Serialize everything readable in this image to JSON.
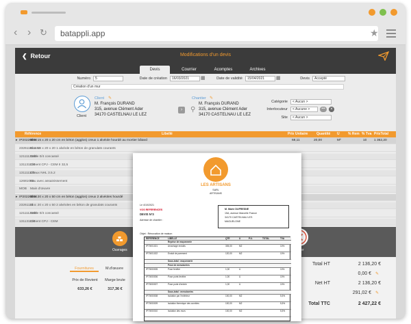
{
  "browser": {
    "url": "batappli.app",
    "dots": [
      "#f29a2e",
      "#7fc04e",
      "#f29a2e"
    ]
  },
  "app": {
    "back_label": "Retour",
    "title": "Modifications d'un devis",
    "accent": "#f29a2e",
    "tabs": [
      "Devis",
      "Courrier",
      "Acomptes",
      "Archives"
    ]
  },
  "form": {
    "numero_label": "Numéro",
    "numero_value": "5",
    "creation_label": "Date de création",
    "creation_value": "16/03/2021",
    "validite_label": "Date de validité",
    "validite_value": "15/04/2021",
    "devis_label": "Devis",
    "devis_value": "Accepté",
    "object_value": "Création d'un mur"
  },
  "client": {
    "label": "Client",
    "caption": "Client",
    "lines": [
      "M. François DURAND",
      "315, avenue Clément Ader",
      "34170 CASTELNAU LE LEZ"
    ]
  },
  "chantier": {
    "label": "Chantier",
    "lines": [
      "M. François DURAND",
      "315, avenue Clément Ader",
      "34170 CASTELNAU LE LEZ"
    ]
  },
  "selects": {
    "categorie_label": "Catégorie",
    "categorie_value": "< Aucun >",
    "interlocuteur_label": "Interlocuteur",
    "interlocuteur_value": "< Aucune >",
    "site_label": "Site",
    "site_value": "< Aucun >"
  },
  "table": {
    "headers": [
      "Référence",
      "Libellé",
      "Prix Unitaire",
      "Quantité",
      "U",
      "% Rem",
      "% Tva",
      "PrixTotal"
    ],
    "rows": [
      {
        "ref": "IP20220006",
        "label": "Bloc 15 x 20 x 20 cm en béton (agglos) creux 1 alvéole hourdé au mortier bâtard",
        "pu": "68,11",
        "qty": "20,00",
        "u": "M²",
        "rem": "",
        "tva": "10",
        "total": "1 362,20",
        "dark": true
      },
      {
        "ref": "232611011152",
        "label": "Bloc 15 x 20 x 20 1 alvéole en béton de granulats courants",
        "pu": "",
        "qty": "",
        "u": "",
        "rem": "",
        "tva": "",
        "total": "",
        "dark": false
      },
      {
        "ref": "1211112200",
        "label": "Sable 0/4 concassé",
        "pu": "",
        "qty": "",
        "u": "",
        "rem": "",
        "tva": "",
        "total": "",
        "dark": false
      },
      {
        "ref": "131131100",
        "label": "Ciment CPJ - CEM II 32,5",
        "pu": "",
        "qty": "",
        "u": "",
        "rem": "",
        "tva": "",
        "total": "",
        "dark": false
      },
      {
        "ref": "131111100",
        "label": "Chaux NHL 3.5.2",
        "pu": "",
        "qty": "",
        "u": "",
        "rem": "",
        "tva": "",
        "total": "",
        "dark": false
      },
      {
        "ref": "12681000",
        "label": "Eau avec assainissement",
        "pu": "",
        "qty": "",
        "u": "",
        "rem": "",
        "tva": "",
        "total": "",
        "dark": false
      },
      {
        "ref": "MOB",
        "label": "Main d'œuvre",
        "pu": "",
        "qty": "",
        "u": "",
        "rem": "",
        "tva": "",
        "total": "",
        "dark": false
      },
      {
        "ref": "IP20220006",
        "label": "Bloc 20 x 20 x 50 cm en béton (agglos) creux 2 alvéoles hourdé",
        "pu": "",
        "qty": "",
        "u": "",
        "rem": "",
        "tva": "",
        "total": "",
        "dark": true
      },
      {
        "ref": "23261111",
        "label": "Bloc 20 x 20 x 50 2 alvéoles en béton de granulats courants",
        "pu": "",
        "qty": "",
        "u": "",
        "rem": "",
        "tva": "",
        "total": "",
        "dark": false
      },
      {
        "ref": "1211112200",
        "label": "Sable 0/4 concassé",
        "pu": "",
        "qty": "",
        "u": "",
        "rem": "",
        "tva": "",
        "total": "",
        "dark": false
      },
      {
        "ref": "131131100",
        "label": "Ciment CPJ - CEM",
        "pu": "",
        "qty": "",
        "u": "",
        "rem": "",
        "tva": "",
        "total": "",
        "dark": false
      }
    ]
  },
  "toolbar": {
    "ouvrages_label": "Ouvrages",
    "effacer_label": "Effacer"
  },
  "bottom": {
    "tabs": [
      "Fournitures",
      "M.d'œuvre"
    ],
    "col1_label": "Prix de Revient",
    "col1_value": "633,26 €",
    "col2_label": "Marge brute",
    "col2_value": "317,36 €"
  },
  "totals": {
    "ht_label": "Total HT",
    "ht_value": "2 136,20 €",
    "remise_value": "0,00 €",
    "net_label": "Net HT",
    "net_value": "2 136,20 €",
    "tva_value": "291,02 €",
    "ttc_label": "Total TTC",
    "ttc_value": "2 427,22 €"
  },
  "doc": {
    "brand": "LES ARTISANS",
    "brand_sub": "SARL",
    "brand_sub2": "ARTISANS",
    "date_line": "Le 4/10/2021",
    "ref_line": "VOS REFERENCES",
    "devis_no": "DEVIS N°3",
    "chantier_line": "Adresse de chantier :",
    "recipient": [
      "M. Marie DUFRESNE",
      "15A, avenue Marcelle France",
      "34170 CASTELNAU LES",
      "MAGUELONE"
    ],
    "objet": "Objet : Rénovation de maison",
    "headers": [
      "REFERENCE",
      "LIBELLE",
      "QTE",
      "U",
      "P.U.",
      "TOTAL",
      "TVA"
    ],
    "rows": [
      {
        "ref": "",
        "label": "Reprise de maçonnerie",
        "qty": "",
        "u": "",
        "pu": "",
        "total": "",
        "tva": ""
      },
      {
        "ref": "IP70001021",
        "label": "Arrachage enduits",
        "qty": "305,00",
        "u": "M2",
        "pu": "",
        "total": "",
        "tva": "10%"
      },
      {
        "ref": "IP70001022",
        "label": "Enduit de parement",
        "qty": "120,00",
        "u": "M2",
        "pu": "",
        "total": "",
        "tva": "10%"
      },
      {
        "ref": "",
        "label": "Sous-total : maçonnerie",
        "qty": "",
        "u": "",
        "pu": "",
        "total": "",
        "tva": ""
      },
      {
        "ref": "",
        "label": "Pose de menuiseries",
        "qty": "",
        "u": "",
        "pu": "",
        "total": "",
        "tva": ""
      },
      {
        "ref": "IP70000005",
        "label": "Pose fenêtre",
        "qty": "1,00",
        "u": "U",
        "pu": "",
        "total": "",
        "tva": "10%"
      },
      {
        "ref": "IP70000006",
        "label": "Pose porte-fenêtre",
        "qty": "1,00",
        "u": "U",
        "pu": "",
        "total": "",
        "tva": "10%"
      },
      {
        "ref": "IP70000007",
        "label": "Pose porte d'entrée",
        "qty": "1,00",
        "u": "U",
        "pu": "",
        "total": "",
        "tva": "10%"
      },
      {
        "ref": "",
        "label": "Sous-total : menuiseries",
        "qty": "",
        "u": "",
        "pu": "",
        "total": "",
        "tva": ""
      },
      {
        "ref": "IP70000008",
        "label": "Isolation par l'extérieur",
        "qty": "100,00",
        "u": "M2",
        "pu": "",
        "total": "",
        "tva": "5,5%"
      },
      {
        "ref": "IP70000009",
        "label": "Isolation thermique des combles",
        "qty": "100,00",
        "u": "M2",
        "pu": "",
        "total": "",
        "tva": "5,5%"
      },
      {
        "ref": "IP70000010",
        "label": "Isolation des murs",
        "qty": "100,00",
        "u": "M2",
        "pu": "",
        "total": "",
        "tva": "5,5%"
      }
    ]
  }
}
